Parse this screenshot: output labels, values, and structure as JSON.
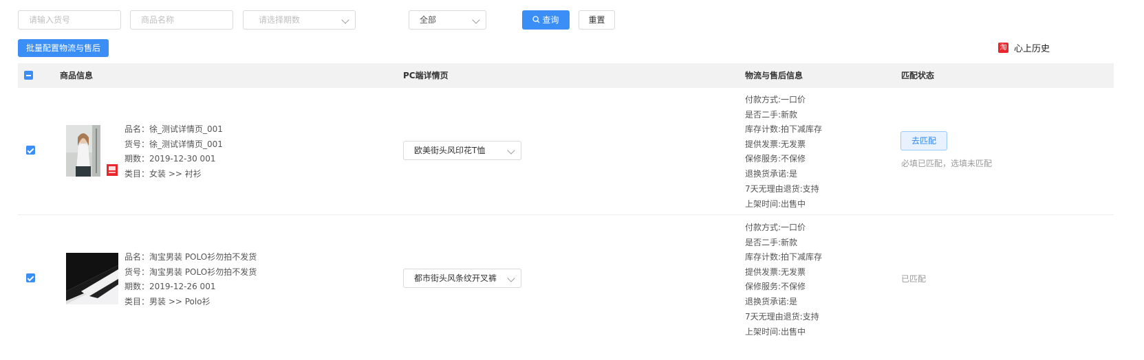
{
  "filters": {
    "item_no_placeholder": "请输入货号",
    "name_placeholder": "商品名称",
    "period_placeholder": "请选择期数",
    "status_value": "全部",
    "search_label": "查询",
    "reset_label": "重置"
  },
  "toolbar": {
    "batch_label": "批量配置物流与售后",
    "shop_name": "心上历史",
    "shop_icon_char": "淘"
  },
  "table": {
    "headers": {
      "product": "商品信息",
      "pc_detail": "PC端详情页",
      "logistics": "物流与售后信息",
      "match_status": "匹配状态"
    },
    "rows": [
      {
        "checked": true,
        "product_lines": [
          "品名：徐_测试详情页_001",
          "货号：徐_测试详情页_001",
          "期数：2019-12-30 001",
          "类目：女装 >> 衬衫"
        ],
        "pc_template": "欧美街头风印花T恤",
        "logistics": [
          "付款方式:一口价",
          "是否二手:新款",
          "库存计数:拍下减库存",
          "提供发票:无发票",
          "保修服务:不保修",
          "退换货承诺:是",
          "7天无理由退货:支持",
          "上架时间:出售中"
        ],
        "match_button": "去匹配",
        "match_note": "必填已匹配，选填未匹配"
      },
      {
        "checked": true,
        "product_lines": [
          "品名：淘宝男装 POLO衫勿拍不发货",
          "货号：淘宝男装 POLO衫勿拍不发货",
          "期数：2019-12-26 001",
          "类目：男装 >> Polo衫"
        ],
        "pc_template": "都市街头风条纹开叉裤",
        "logistics": [
          "付款方式:一口价",
          "是否二手:新款",
          "库存计数:拍下减库存",
          "提供发票:无发票",
          "保修服务:不保修",
          "退换货承诺:是",
          "7天无理由退货:支持",
          "上架时间:出售中"
        ],
        "match_note": "已匹配"
      }
    ]
  },
  "colors": {
    "primary": "#3a8ef6",
    "shop_icon": "#e8262c"
  }
}
